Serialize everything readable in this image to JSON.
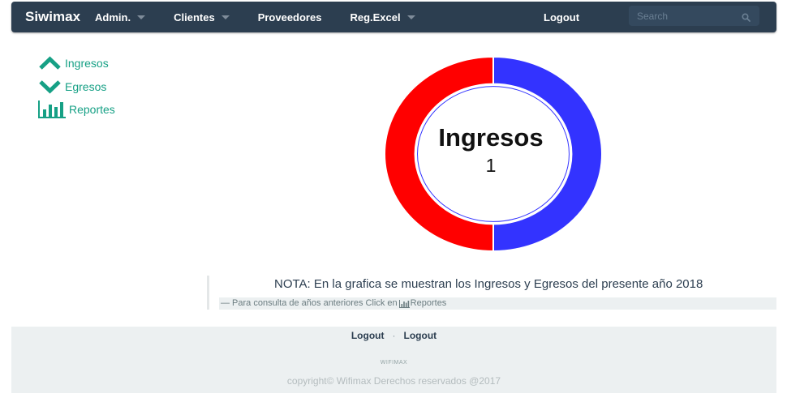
{
  "navbar": {
    "brand": "Siwimax",
    "items": [
      {
        "label": "Admin.",
        "dropdown": true
      },
      {
        "label": "Clientes",
        "dropdown": true
      },
      {
        "label": "Proveedores",
        "dropdown": false
      },
      {
        "label": "Reg.Excel",
        "dropdown": true
      }
    ],
    "logout": "Logout",
    "search_placeholder": "Search",
    "search_icon": "search-icon"
  },
  "sidebar": {
    "items": [
      {
        "label": "Ingresos",
        "icon": "chevron-up-icon"
      },
      {
        "label": "Egresos",
        "icon": "chevron-down-icon"
      },
      {
        "label": "Reportes",
        "icon": "bar-chart-icon"
      }
    ]
  },
  "chart_data": {
    "type": "pie",
    "variant": "doughnut",
    "center_title": "Ingresos",
    "center_value": "1",
    "slices": [
      {
        "label": "Ingresos",
        "value": 1,
        "color": "#3333ff"
      },
      {
        "label": "Egresos",
        "value": 1,
        "color": "#ff0000"
      }
    ]
  },
  "note": {
    "text": "NOTA: En la grafica se muestran los Ingresos y Egresos del presente año 2018",
    "sub_prefix": "— Para consulta de años anteriores Click en",
    "sub_link": "Reportes"
  },
  "footer": {
    "links": [
      "Logout",
      "Logout"
    ],
    "separator": "·",
    "brand": "WIFIMAX",
    "copyright": "copyright© Wifimax Derechos reservados @2017"
  },
  "colors": {
    "navbar_bg": "#2c3e50",
    "accent": "#16a085",
    "footer_bg": "#ecf0f1"
  }
}
